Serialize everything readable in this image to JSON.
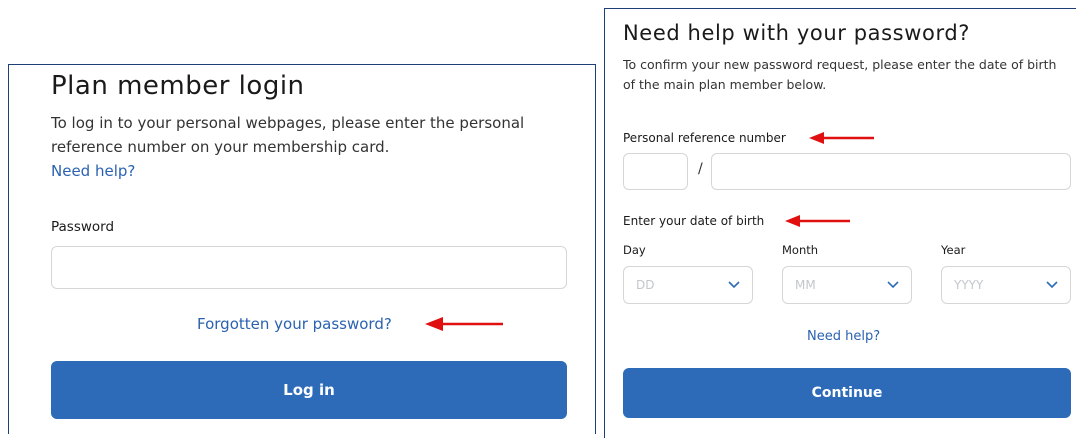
{
  "login": {
    "title": "Plan member login",
    "description": "To log in to your personal webpages, please enter the personal reference number on your membership card.",
    "help_link": "Need help?",
    "password_label": "Password",
    "password_value": "",
    "forgot_link": "Forgotten your password?",
    "login_button": "Log in"
  },
  "reset": {
    "title": "Need help with your password?",
    "description": "To confirm your new password request, please enter the date of birth of the main plan member below.",
    "ref_label": "Personal reference number",
    "ref_separator": "/",
    "dob_label": "Enter your date of birth",
    "day_label": "Day",
    "month_label": "Month",
    "year_label": "Year",
    "day_placeholder": "DD",
    "month_placeholder": "MM",
    "year_placeholder": "YYYY",
    "help_link": "Need help?",
    "continue_button": "Continue"
  },
  "colors": {
    "accent": "#2d6bb9",
    "link": "#2a62b0",
    "annotation_arrow": "#e01010",
    "panel_border": "#1f3f78"
  },
  "icons": [
    "chevron-down-icon",
    "red-arrow-annotation"
  ]
}
